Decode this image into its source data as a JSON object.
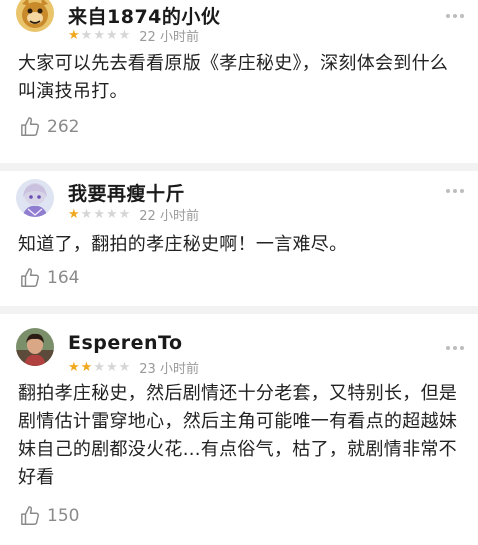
{
  "colors": {
    "star_on": "#f0a81e",
    "star_off": "#d6d6d6",
    "meta_text": "#9a9a9a",
    "divider": "#f2f2f2"
  },
  "comments": [
    {
      "username": "来自1874的小伙",
      "avatar_icon": "cartoon-avatar",
      "rating": 1,
      "rating_max": 5,
      "time": "22 小时前",
      "text": "大家可以先去看看原版《孝庄秘史》，深刻体会到什么叫演技吊打。",
      "likes": "262",
      "like_icon": "thumbs-up-icon",
      "more_icon": "more-icon"
    },
    {
      "username": "我要再瘦十斤",
      "avatar_icon": "anime-avatar",
      "rating": 1,
      "rating_max": 5,
      "time": "22 小时前",
      "text": "知道了，翻拍的孝庄秘史啊！一言难尽。",
      "likes": "164",
      "like_icon": "thumbs-up-icon",
      "more_icon": "more-icon"
    },
    {
      "username": "EsperenTo",
      "avatar_icon": "photo-avatar",
      "rating": 2,
      "rating_max": 5,
      "time": "23 小时前",
      "text": "翻拍孝庄秘史，然后剧情还十分老套，又特别长，但是剧情估计雷穿地心，然后主角可能唯一有看点的超越妹妹自己的剧都没火花...有点俗气，枯了，就剧情非常不好看",
      "likes": "150",
      "like_icon": "thumbs-up-icon",
      "more_icon": "more-icon"
    }
  ]
}
